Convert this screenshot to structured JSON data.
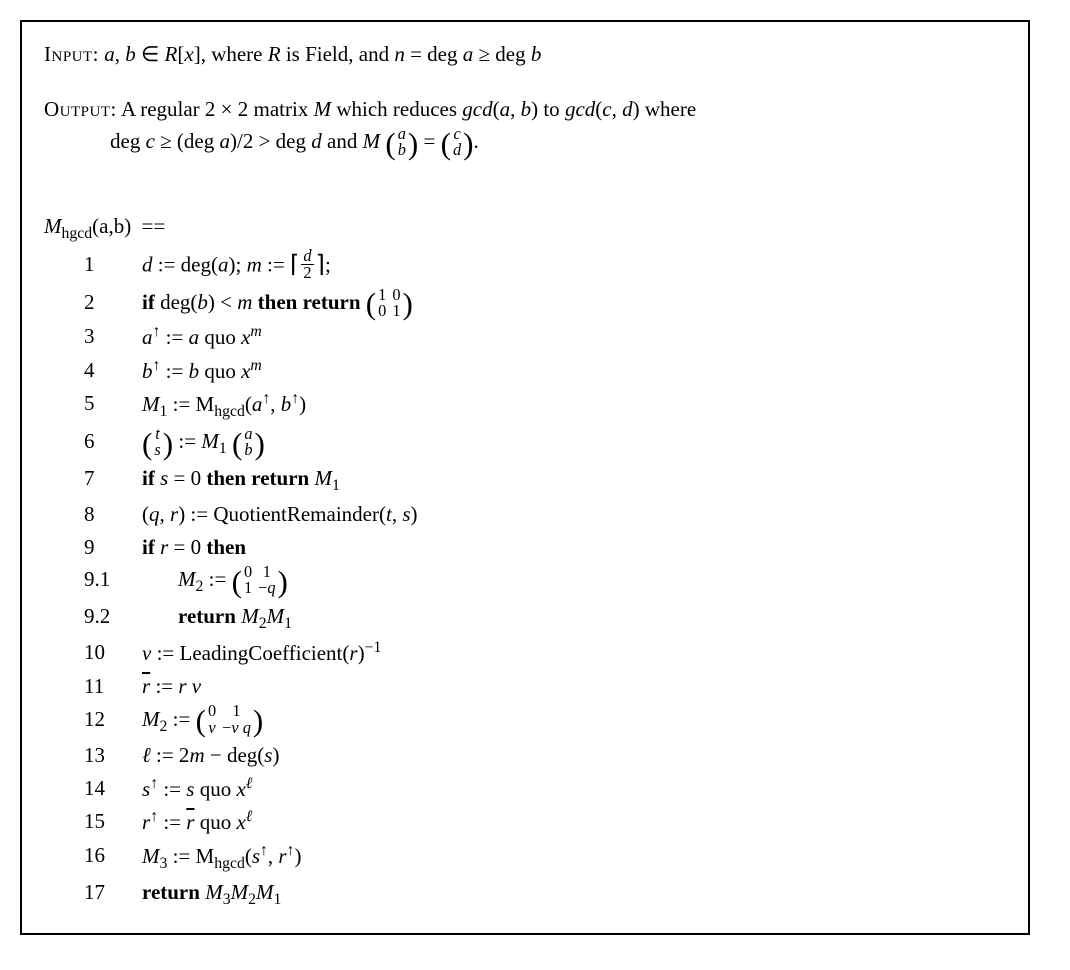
{
  "input": {
    "label": "Input:",
    "text_html": "<span class='it'>a</span>, <span class='it'>b</span> ∈ <span class='it'>R</span>[<span class='it'>x</span>], where <span class='it'>R</span> is Field, and <span class='it'>n</span> = deg <span class='it'>a</span> ≥ deg <span class='it'>b</span>"
  },
  "output": {
    "label": "Output:",
    "text_html": "A regular 2 × 2 matrix <span class='it'>M</span> which reduces <span class='it'>gcd</span>(<span class='it'>a</span>, <span class='it'>b</span>) to <span class='it'>gcd</span>(<span class='it'>c</span>, <span class='it'>d</span>) where",
    "cont_html": "deg <span class='it'>c</span> ≥ (deg <span class='it'>a</span>)/2 &gt; deg <span class='it'>d</span> and <span class='it'>M</span> <span class='smmatrix'><span class='paren'>(</span><span class='mgrid onecol'><span class='it'>a</span><span class='it'>b</span></span><span class='paren'>)</span></span> = <span class='smmatrix'><span class='paren'>(</span><span class='mgrid onecol'><span class='it'>c</span><span class='it'>d</span></span><span class='paren'>)</span></span>."
  },
  "fn_header_html": "<span class='it'>M</span><sub>hgcd</sub>(a,b)&nbsp;&nbsp;==",
  "lines": [
    {
      "no": "1",
      "indent": 0,
      "html": "<span class='it'>d</span> := deg(<span class='it'>a</span>); <span class='it'>m</span> := <span class='ceilfrac'><span class='ceil-l'>⌈</span><span class='frac'><span class='num it'>d</span><span class='den'>2</span></span><span class='ceil-r'>⌉</span></span>;"
    },
    {
      "no": "2",
      "indent": 0,
      "html": "<span class='kw'>if</span> deg(<span class='it'>b</span>) &lt; <span class='it'>m</span> <span class='kw'>then return</span> <span class='smmatrix'><span class='paren'>(</span><span class='mgrid'><span>1</span><span>0</span><span>0</span><span>1</span></span><span class='paren'>)</span></span>"
    },
    {
      "no": "3",
      "indent": 0,
      "html": "<span class='it'>a</span><sup>↑</sup> := <span class='it'>a</span> quo <span class='it'>x</span><sup><span class='it'>m</span></sup>"
    },
    {
      "no": "4",
      "indent": 0,
      "html": "<span class='it'>b</span><sup>↑</sup> := <span class='it'>b</span> quo <span class='it'>x</span><sup><span class='it'>m</span></sup>"
    },
    {
      "no": "5",
      "indent": 0,
      "html": "<span class='it'>M</span><sub>1</sub> := M<sub>hgcd</sub>(<span class='it'>a</span><sup>↑</sup>, <span class='it'>b</span><sup>↑</sup>)"
    },
    {
      "no": "6",
      "indent": 0,
      "html": "<span class='smmatrix'><span class='paren'>(</span><span class='mgrid onecol'><span class='it'>t</span><span class='it'>s</span></span><span class='paren'>)</span></span> := <span class='it'>M</span><sub>1</sub> <span class='smmatrix'><span class='paren'>(</span><span class='mgrid onecol'><span class='it'>a</span><span class='it'>b</span></span><span class='paren'>)</span></span>"
    },
    {
      "no": "7",
      "indent": 0,
      "html": "<span class='kw'>if</span> <span class='it'>s</span> = 0 <span class='kw'>then return</span> <span class='it'>M</span><sub>1</sub>"
    },
    {
      "no": "8",
      "indent": 0,
      "html": "(<span class='it'>q</span>, <span class='it'>r</span>) := QuotientRemainder(<span class='it'>t</span>, <span class='it'>s</span>)"
    },
    {
      "no": "9",
      "indent": 0,
      "html": "<span class='kw'>if</span> <span class='it'>r</span> = 0 <span class='kw'>then</span>"
    },
    {
      "no": "9.1",
      "indent": 1,
      "html": "<span class='it'>M</span><sub>2</sub> := <span class='smmatrix'><span class='paren'>(</span><span class='mgrid'><span>0</span><span>1</span><span>1</span><span>−<span class='it'>q</span></span></span><span class='paren'>)</span></span>"
    },
    {
      "no": "9.2",
      "indent": 1,
      "html": "<span class='kw'>return</span> <span class='it'>M</span><sub>2</sub><span class='it'>M</span><sub>1</sub>"
    },
    {
      "no": "10",
      "indent": 0,
      "html": "<span class='it'>v</span> := LeadingCoefficient(<span class='it'>r</span>)<sup>−1</sup>"
    },
    {
      "no": "11",
      "indent": 0,
      "html": "<span class='it overline'>r</span> := <span class='it'>r v</span>"
    },
    {
      "no": "12",
      "indent": 0,
      "html": "<span class='it'>M</span><sub>2</sub> := <span class='smmatrix'><span class='paren'>(</span><span class='mgrid'><span>0</span><span>1</span><span class='it'>v</span><span>−<span class='it'>v q</span></span></span><span class='paren'>)</span></span>"
    },
    {
      "no": "13",
      "indent": 0,
      "html": "<span class='it'>ℓ</span> := 2<span class='it'>m</span> − deg(<span class='it'>s</span>)"
    },
    {
      "no": "14",
      "indent": 0,
      "html": "<span class='it'>s</span><sup>↑</sup> := <span class='it'>s</span> quo <span class='it'>x</span><sup><span class='it'>ℓ</span></sup>"
    },
    {
      "no": "15",
      "indent": 0,
      "html": "<span class='it'>r</span><sup>↑</sup> := <span class='it overline'>r</span> quo <span class='it'>x</span><sup><span class='it'>ℓ</span></sup>"
    },
    {
      "no": "16",
      "indent": 0,
      "html": "<span class='it'>M</span><sub>3</sub> := M<sub>hgcd</sub>(<span class='it'>s</span><sup>↑</sup>, <span class='it'>r</span><sup>↑</sup>)"
    },
    {
      "no": "17",
      "indent": 0,
      "html": "<span class='kw'>return</span> <span class='it'>M</span><sub>3</sub><span class='it'>M</span><sub>2</sub><span class='it'>M</span><sub>1</sub>"
    }
  ]
}
